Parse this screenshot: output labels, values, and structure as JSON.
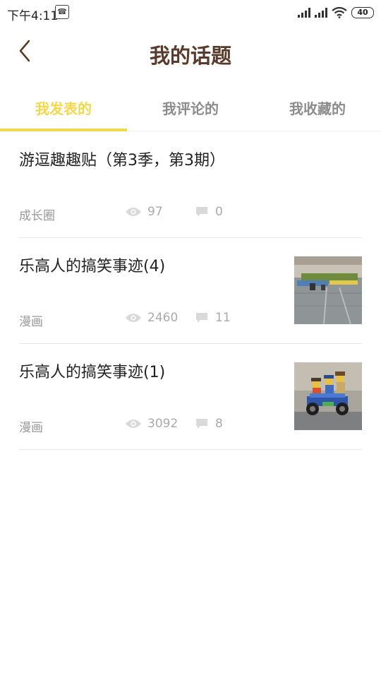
{
  "status_bar": {
    "time": "下午4:11",
    "app_icon_text": "☎",
    "battery": "40"
  },
  "header": {
    "title": "我的话题"
  },
  "tabs": [
    {
      "label": "我发表的",
      "active": true
    },
    {
      "label": "我评论的",
      "active": false
    },
    {
      "label": "我收藏的",
      "active": false
    }
  ],
  "topics": [
    {
      "title": "游逗趣趣贴（第3季，第3期）",
      "category": "成长圈",
      "views": "97",
      "comments": "0",
      "has_thumbnail": false
    },
    {
      "title": "乐高人的搞笑事迹(4)",
      "category": "漫画",
      "views": "2460",
      "comments": "11",
      "has_thumbnail": true
    },
    {
      "title": "乐高人的搞笑事迹(1)",
      "category": "漫画",
      "views": "3092",
      "comments": "8",
      "has_thumbnail": true
    }
  ],
  "colors": {
    "accent": "#f2d84a",
    "title_brown": "#5a3a2a",
    "muted": "#999999"
  },
  "icons": {
    "back": "back-arrow-icon",
    "views": "eye-icon",
    "comments": "comment-bubble-icon"
  }
}
